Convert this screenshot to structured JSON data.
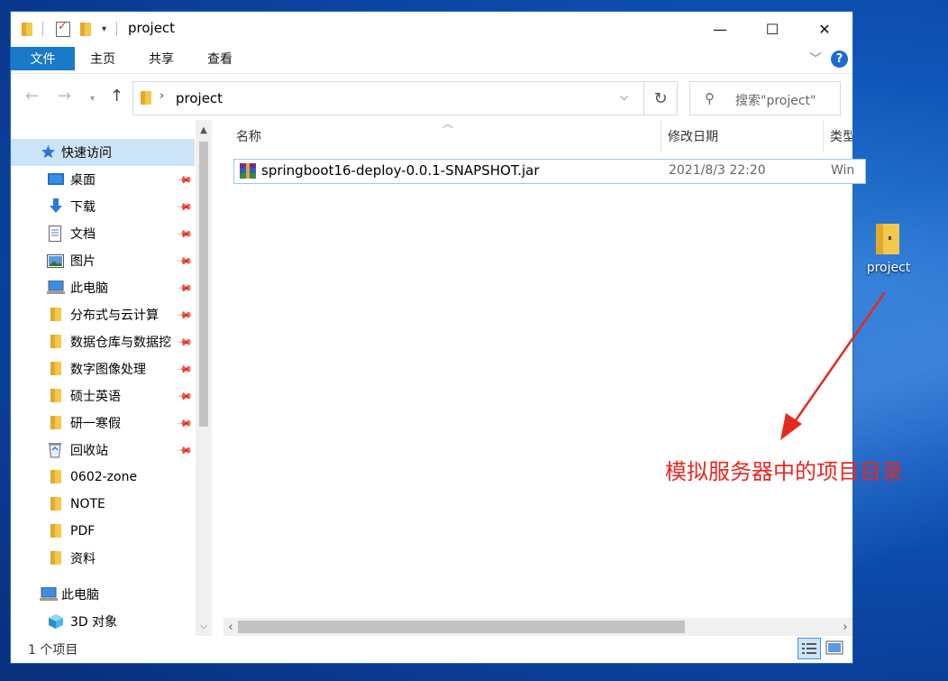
{
  "window": {
    "title": "project",
    "controls": {
      "minimize": "—",
      "maximize": "☐",
      "close": "✕"
    }
  },
  "ribbon": {
    "tabs": [
      "文件",
      "主页",
      "共享",
      "查看"
    ],
    "help": "?"
  },
  "address": {
    "path": "project",
    "search_placeholder": "搜索\"project\""
  },
  "nav": {
    "items": [
      {
        "label": "快速访问",
        "icon": "star-icon"
      },
      {
        "label": "桌面",
        "icon": "desktop-icon"
      },
      {
        "label": "下载",
        "icon": "download-icon"
      },
      {
        "label": "文档",
        "icon": "document-icon"
      },
      {
        "label": "图片",
        "icon": "picture-icon"
      },
      {
        "label": "此电脑",
        "icon": "computer-icon"
      },
      {
        "label": "分布式与云计算",
        "icon": "folder-icon"
      },
      {
        "label": "数据仓库与数据挖",
        "icon": "folder-icon"
      },
      {
        "label": "数字图像处理",
        "icon": "folder-icon"
      },
      {
        "label": "硕士英语",
        "icon": "folder-icon"
      },
      {
        "label": "研一寒假",
        "icon": "folder-icon"
      },
      {
        "label": "回收站",
        "icon": "recycle-bin-icon"
      },
      {
        "label": "0602-zone",
        "icon": "folder-icon"
      },
      {
        "label": "NOTE",
        "icon": "folder-icon"
      },
      {
        "label": "PDF",
        "icon": "folder-icon"
      },
      {
        "label": "资料",
        "icon": "folder-icon"
      },
      {
        "label": "此电脑",
        "icon": "computer-icon"
      },
      {
        "label": "3D 对象",
        "icon": "3d-objects-icon"
      }
    ]
  },
  "columns": {
    "name": "名称",
    "modified": "修改日期",
    "type": "类型"
  },
  "files": [
    {
      "name": "springboot16-deploy-0.0.1-SNAPSHOT.jar",
      "modified": "2021/8/3 22:20",
      "type": "Win"
    }
  ],
  "status": {
    "count": "1 个项目"
  },
  "desktop": {
    "icon_label": "project",
    "annotation": "模拟服务器中的项目目录"
  },
  "colors": {
    "accent": "#1979ca",
    "selection": "#cce4f7",
    "annotation": "#e8281f"
  }
}
